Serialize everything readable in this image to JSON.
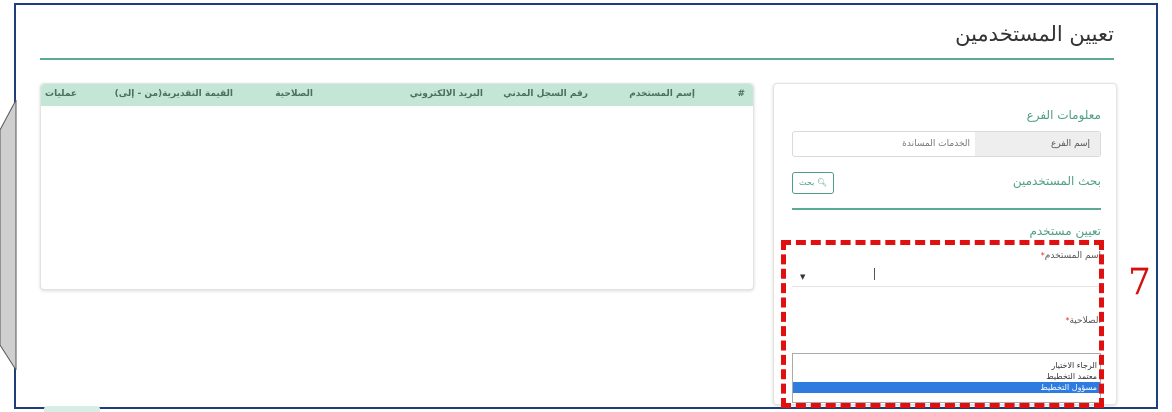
{
  "page": {
    "title": "تعيين المستخدمين"
  },
  "table": {
    "columns": [
      "#",
      "إسم المستخدم",
      "رقم السجل المدني",
      "البريد الالكتروني",
      "الصلاحية",
      "القيمة التقديرية(من - إلى)",
      "عمليات"
    ]
  },
  "branch_info": {
    "section_title": "معلومات الفرع",
    "label": "إسم الفرع",
    "value": "الخدمات المساندة"
  },
  "search_users": {
    "section_title": "بحث المستخدمين",
    "button_label": "بحث",
    "icon": "search-icon"
  },
  "assign_user": {
    "section_title": "تعيين مستخدم",
    "username_label": "اسم المستخدم",
    "permission_label": "الصلاحية",
    "required_mark": "*",
    "dropdown_options": [
      "الرجاء الاختيار",
      "معتمد التخطيط",
      "مسؤول التخطيط"
    ],
    "selected_option": "مسؤول التخطيط"
  },
  "annotation": {
    "step_number": "7",
    "color": "#e01010"
  },
  "colors": {
    "accent": "#5aaa95",
    "header_bg": "#c4e6d6",
    "selection": "#2f7ce0"
  }
}
